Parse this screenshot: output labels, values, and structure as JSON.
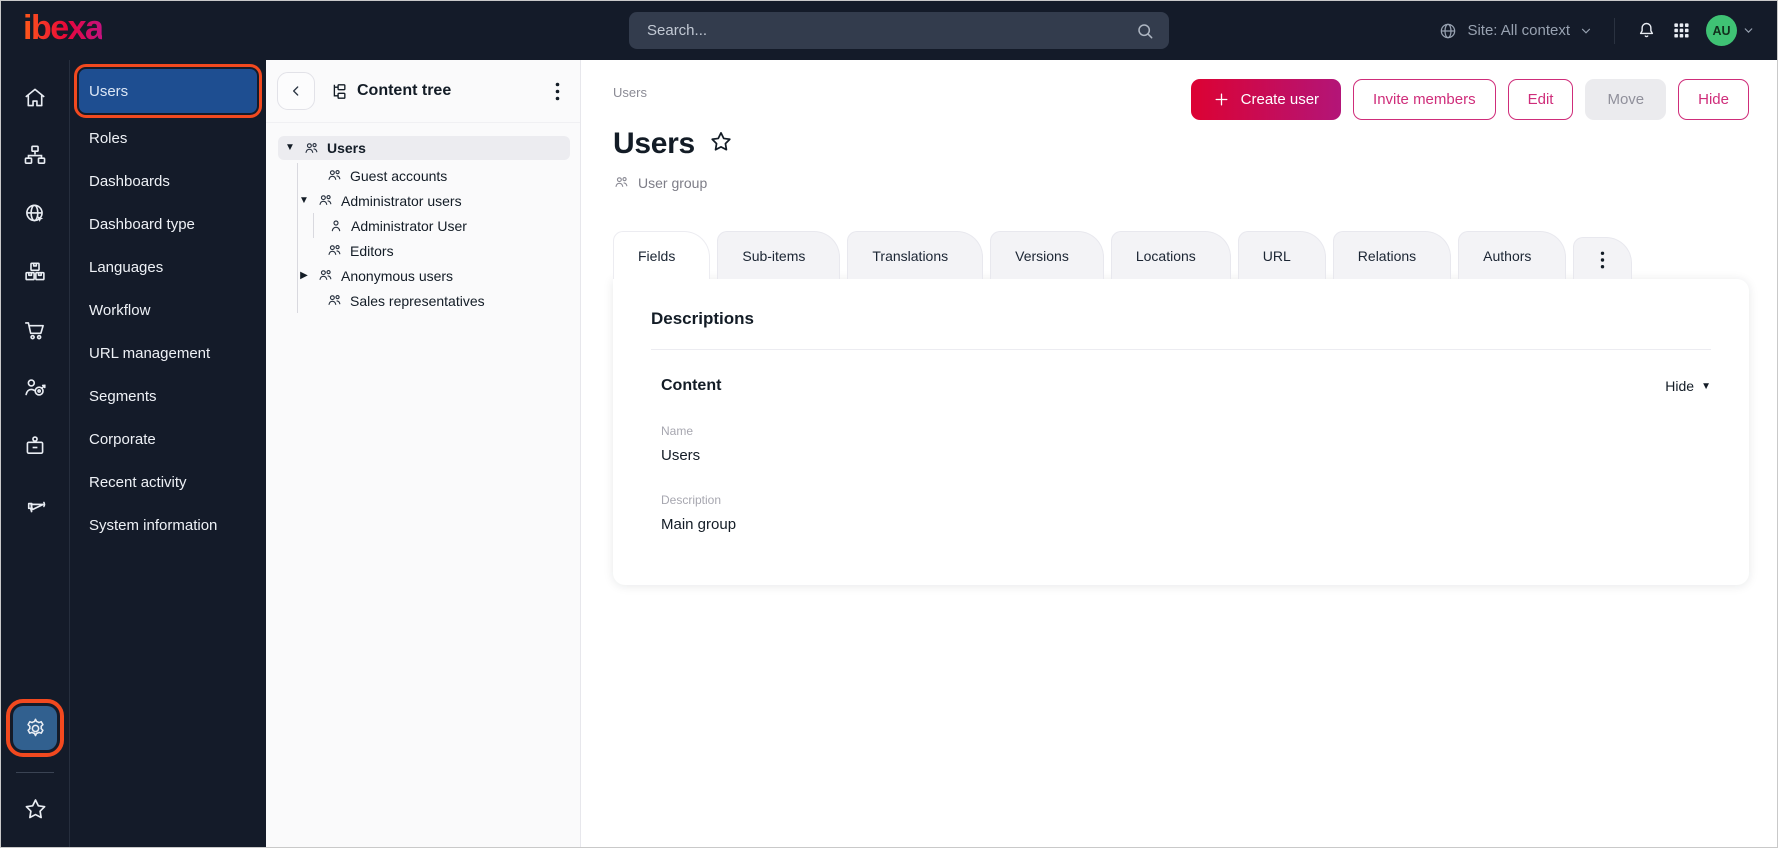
{
  "topbar": {
    "logo_text": "ibexa",
    "search_placeholder": "Search...",
    "site_context_label": "Site: All context",
    "avatar_initials": "AU"
  },
  "rail": {
    "icons": [
      "home",
      "content-structure",
      "site",
      "products",
      "commerce",
      "personalization",
      "corporate",
      "marketing"
    ],
    "settings": "settings",
    "bookmarks": "bookmarks"
  },
  "sidebar": {
    "items": [
      {
        "label": "Users",
        "active": true
      },
      {
        "label": "Roles"
      },
      {
        "label": "Dashboards"
      },
      {
        "label": "Dashboard type"
      },
      {
        "label": "Languages"
      },
      {
        "label": "Workflow"
      },
      {
        "label": "URL management"
      },
      {
        "label": "Segments"
      },
      {
        "label": "Corporate"
      },
      {
        "label": "Recent activity"
      },
      {
        "label": "System information"
      }
    ]
  },
  "content_tree": {
    "title": "Content tree",
    "nodes": [
      {
        "label": "Users",
        "level": 0,
        "expanded": true,
        "selected": true,
        "icon": "user-group"
      },
      {
        "label": "Guest accounts",
        "level": 1,
        "icon": "user-group"
      },
      {
        "label": "Administrator users",
        "level": 1,
        "expanded": true,
        "icon": "user-group"
      },
      {
        "label": "Administrator User",
        "level": 2,
        "icon": "user"
      },
      {
        "label": "Editors",
        "level": 1,
        "icon": "user-group"
      },
      {
        "label": "Anonymous users",
        "level": 1,
        "collapsed": true,
        "icon": "user-group"
      },
      {
        "label": "Sales representatives",
        "level": 1,
        "icon": "user-group"
      }
    ]
  },
  "main": {
    "breadcrumb": "Users",
    "page_title": "Users",
    "content_type": "User group",
    "actions": {
      "create": "Create user",
      "invite": "Invite members",
      "edit": "Edit",
      "move": "Move",
      "hide": "Hide"
    },
    "tabs": [
      {
        "label": "Fields",
        "active": true
      },
      {
        "label": "Sub-items"
      },
      {
        "label": "Translations"
      },
      {
        "label": "Versions"
      },
      {
        "label": "Locations"
      },
      {
        "label": "URL"
      },
      {
        "label": "Relations"
      },
      {
        "label": "Authors"
      }
    ],
    "card": {
      "heading": "Descriptions",
      "section_title": "Content",
      "collapse_label": "Hide",
      "fields": [
        {
          "label": "Name",
          "value": "Users"
        },
        {
          "label": "Description",
          "value": "Main group"
        }
      ]
    }
  },
  "colors": {
    "topbar_bg": "#141b29",
    "accent_red": "#db0032",
    "accent_gradient_end": "#b31578",
    "highlight_orange": "#f2491f",
    "selected_blue": "#1e4e91",
    "avatar_green": "#3fc274"
  }
}
